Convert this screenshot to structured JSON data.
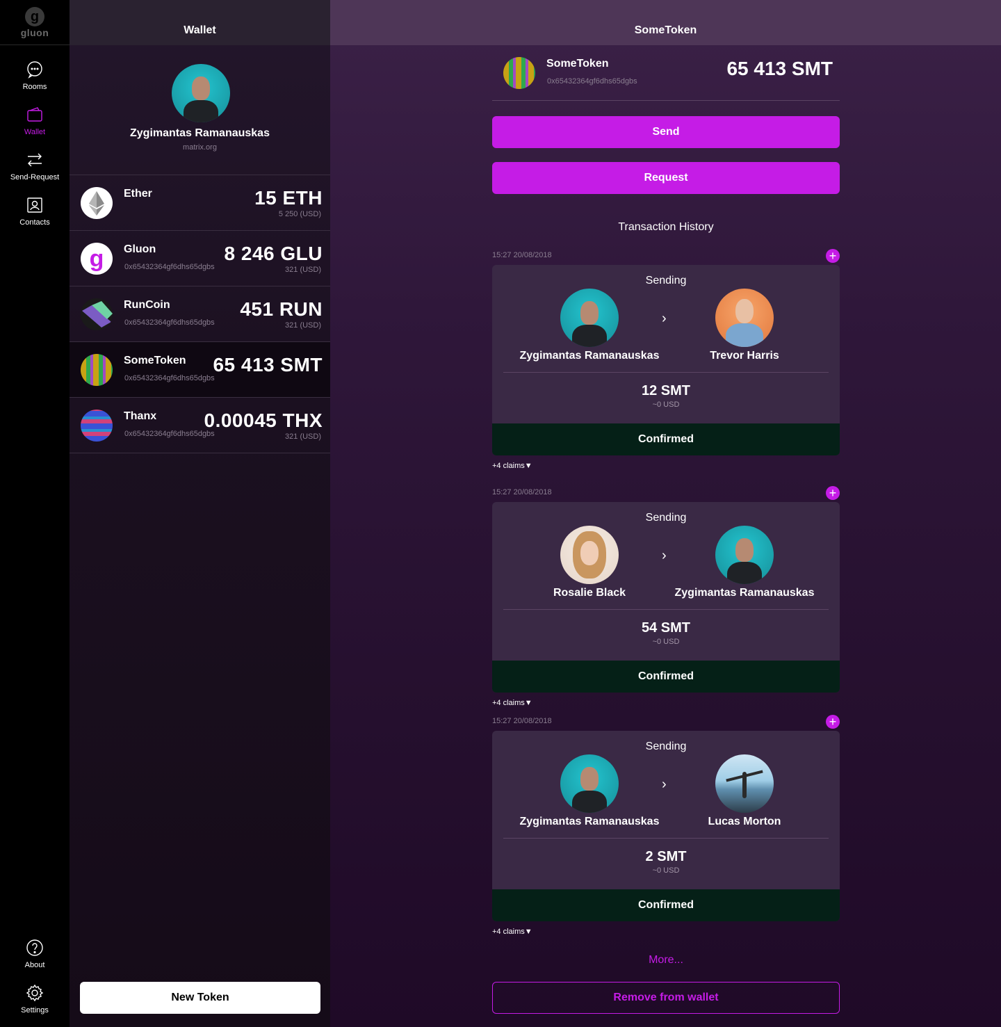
{
  "app": {
    "logo_text": "gluon",
    "logo_letter": "g",
    "accent_color": "#c51ce6",
    "confirmed_color": "#052017"
  },
  "nav": {
    "items": [
      {
        "label": "Rooms",
        "icon": "chat-bubble-icon"
      },
      {
        "label": "Wallet",
        "icon": "wallet-icon",
        "active": true
      },
      {
        "label": "Send-Request",
        "icon": "swap-arrows-icon"
      },
      {
        "label": "Contacts",
        "icon": "contacts-icon"
      }
    ],
    "bottom_items": [
      {
        "label": "About",
        "icon": "help-icon"
      },
      {
        "label": "Settings",
        "icon": "gear-icon"
      }
    ]
  },
  "wallet": {
    "title": "Wallet",
    "user": {
      "name": "Zygimantas Ramanauskas",
      "server": "matrix.org"
    },
    "tokens": [
      {
        "name": "Ether",
        "address": "",
        "amount": "15 ETH",
        "usd": "5 250 (USD)",
        "icon": "ethereum-icon"
      },
      {
        "name": "Gluon",
        "address": "0x65432364gf6dhs65dgbs",
        "amount": "8 246 GLU",
        "usd": "321 (USD)",
        "icon": "gluon-icon"
      },
      {
        "name": "RunCoin",
        "address": "0x65432364gf6dhs65dgbs",
        "amount": "451 RUN",
        "usd": "321 (USD)",
        "icon": "runcoin-icon"
      },
      {
        "name": "SomeToken",
        "address": "0x65432364gf6dhs65dgbs",
        "amount": "65 413 SMT",
        "usd": "",
        "icon": "sometoken-icon",
        "selected": true
      },
      {
        "name": "Thanx",
        "address": "0x65432364gf6dhs65dgbs",
        "amount": "0.00045 THX",
        "usd": "321 (USD)",
        "icon": "thanx-icon"
      }
    ],
    "new_token_label": "New Token"
  },
  "detail": {
    "title": "SomeToken",
    "token": {
      "name": "SomeToken",
      "address": "0x65432364gf6dhs65dgbs",
      "amount": "65 413 SMT"
    },
    "send_label": "Send",
    "request_label": "Request",
    "history_title": "Transaction History",
    "transactions": [
      {
        "date": "15:27 20/08/2018",
        "status": "Sending",
        "from": "Zygimantas Ramanauskas",
        "to": "Trevor Harris",
        "amount": "12 SMT",
        "usd": "~0 USD",
        "state": "Confirmed",
        "claims": "+4 claims▼"
      },
      {
        "date": "15:27 20/08/2018",
        "status": "Sending",
        "from": "Rosalie Black",
        "to": "Zygimantas Ramanauskas",
        "amount": "54 SMT",
        "usd": "~0 USD",
        "state": "Confirmed",
        "claims": "+4 claims▼"
      },
      {
        "date": "15:27 20/08/2018",
        "status": "Sending",
        "from": "Zygimantas Ramanauskas",
        "to": "Lucas Morton",
        "amount": "2 SMT",
        "usd": "~0 USD",
        "state": "Confirmed",
        "claims": "+4 claims▼"
      }
    ],
    "more_label": "More...",
    "remove_label": "Remove from wallet"
  }
}
